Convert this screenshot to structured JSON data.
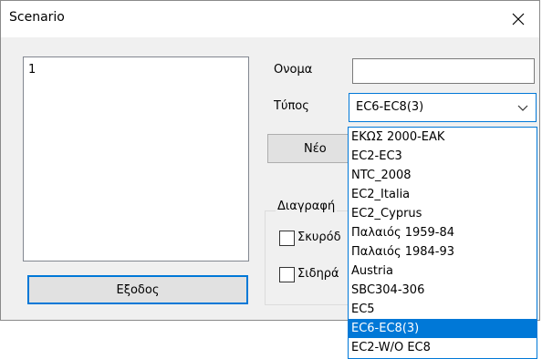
{
  "window": {
    "title": "Scenario"
  },
  "list": {
    "items": [
      "1"
    ]
  },
  "form": {
    "name_label": "Ονομα",
    "name_value": "",
    "type_label": "Τύπος",
    "type_value": "EC6-EC8(3)",
    "new_button": "Νέο",
    "exit_button": "Εξοδος",
    "delete_group_title": "Διαγραφή",
    "checkbox_concrete": "Σκυρόδ",
    "checkbox_steel": "Σιδηρά"
  },
  "dropdown": {
    "options": [
      "ΕΚΩΣ 2000-ΕΑΚ",
      "EC2-EC3",
      "NTC_2008",
      "EC2_Italia",
      "EC2_Cyprus",
      "Παλαιός 1959-84",
      "Παλαιός 1984-93",
      "Austria",
      "SBC304-306",
      "EC5",
      "EC6-EC8(3)",
      "EC2-W/O EC8"
    ],
    "selected_index": 10
  },
  "icons": {
    "close": "close-icon",
    "chevron": "chevron-down-icon"
  },
  "colors": {
    "accent": "#0078d7"
  }
}
